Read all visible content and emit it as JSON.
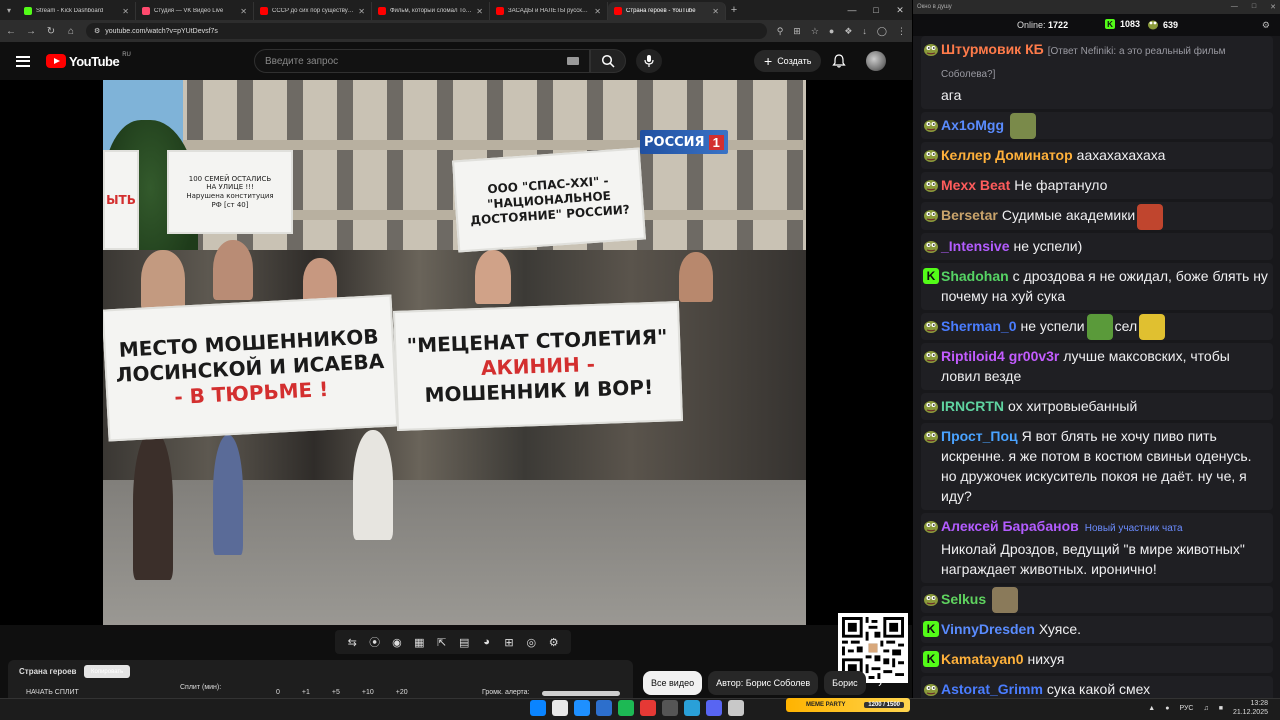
{
  "browser": {
    "tabs": [
      {
        "title": "Stream - Kick Dashboard",
        "color": "#53fc18"
      },
      {
        "title": "Студия — VK Видео Live",
        "color": "#ff4a6e"
      },
      {
        "title": "СССР до сих пор существует? ...",
        "color": "#ff0000"
      },
      {
        "title": "Фильм, который сломал Томь...",
        "color": "#ff0000"
      },
      {
        "title": "ЗАСАДЫ и НАЛЁТЫ русских Р...",
        "color": "#ff0000"
      },
      {
        "title": "Страна героев - YouTube",
        "color": "#ff0000"
      }
    ],
    "url": "youtube.com/watch?v=pYUtDevsf7s"
  },
  "youtube": {
    "logo_text": "YouTube",
    "region": "RU",
    "search_placeholder": "Введите запрос",
    "create_label": "Создать"
  },
  "video": {
    "channel_logo": "РОССИЯ",
    "channel_num": "1",
    "banner_left": [
      "МЕСТО МОШЕННИКОВ",
      "ЛОСИНСКОЙ И ИСАЕВА",
      "- В ТЮРЬМЕ !"
    ],
    "banner_right": [
      "\"МЕЦЕНАТ СТОЛЕТИЯ\"",
      "АКИНИН -",
      "МОШЕННИК И ВОР!"
    ],
    "banner_top_mid": [
      "ООО \"СПАС-XXI\" -",
      "\"НАЦИОНАЛЬНОЕ",
      "ДОСТОЯНИЕ\" РОССИИ?"
    ],
    "banner_top_left": [
      "100 СЕМЕЙ ОСТАЛИСЬ",
      "НА УЛИЦЕ !!!",
      "Нарушена конституция",
      "РФ [ст 40]"
    ],
    "banner_edge": "ЫТЬ"
  },
  "below": {
    "panel_title": "Страна героев",
    "panel_tag": "Копировать",
    "start_split": "НАЧАТЬ СПЛИТ",
    "split_label": "Сплит (мин):",
    "split_values": [
      "0",
      "+1",
      "+5",
      "+10",
      "+20"
    ],
    "volume_label": "Громк. алерта:",
    "chips": [
      "Все видео",
      "Автор: Борис Соболев",
      "Борис"
    ]
  },
  "chat": {
    "window_title": "Окно в душу",
    "online_label": "Online:",
    "online_count": "1722",
    "kick_count": "1083",
    "other_count": "639",
    "messages": [
      {
        "name": "Штурмовик КБ",
        "color": "#ff7b4a",
        "reply": "[Ответ Nefiniki: а это реальный фильм Соболева?]",
        "text": "ага",
        "badge": "pepe"
      },
      {
        "name": "Ax1oMgg",
        "color": "#5a8cff",
        "text": "",
        "badge": "pepe",
        "emote": "#7a8a4a"
      },
      {
        "name": "Келлер Доминатор",
        "color": "#ffb13b",
        "text": "аахахахахаха",
        "badge": "pepe"
      },
      {
        "name": "Mexx Beat",
        "color": "#ff5c5c",
        "text": "Не фартануло",
        "badge": "pepe"
      },
      {
        "name": "Bersetar",
        "color": "#c9a36b",
        "text": "Судимые академики",
        "badge": "pepe",
        "emote": "#c0452e"
      },
      {
        "name": "_Intensive",
        "color": "#b35cff",
        "text": "не успели)",
        "badge": "pepe"
      },
      {
        "name": "Shadohan",
        "color": "#56d364",
        "text": "с дроздова я не ожидал, боже блять ну почему на хуй сука",
        "badge": "kick"
      },
      {
        "name": "Sherman_0",
        "color": "#4a7dff",
        "text": "не успели",
        "text2": "сел",
        "badge": "pepe",
        "emote": "#5a9a3a",
        "emote2": "#e0c030"
      },
      {
        "name": "Riptiloid4",
        "color": "#c35cff",
        "name2": "gr00v3r",
        "color2": "#c35cff",
        "text": "лучше максовских, чтобы ловил везде",
        "badge": "pepe"
      },
      {
        "name": "IRNCRTN",
        "color": "#5fd3a0",
        "text": "ох хитровыебанный",
        "badge": "pepe"
      },
      {
        "name": "Прост_Поц",
        "color": "#4aa3ff",
        "text": "Я вот блять не хочу пиво пить искренне. я же потом в костюм свиньи оденусь. но дружочек искуситель покоя не даёт. ну че, я иду?",
        "badge": "pepe"
      },
      {
        "name": "Алексей Барабанов",
        "color": "#b35cff",
        "newtag": "Новый участник чата",
        "text": "Николай Дроздов, ведущий \"в мире животных\" награждает животных. иронично!",
        "badge": "pepe"
      },
      {
        "name": "Selkus",
        "color": "#5fd35f",
        "text": "",
        "badge": "pepe",
        "emote": "#8a7a5a"
      },
      {
        "name": "VinnyDresden",
        "color": "#5a8cff",
        "text": "Хуясе.",
        "badge": "kick"
      },
      {
        "name": "Kamatayan0",
        "color": "#ffb13b",
        "text": "нихуя",
        "badge": "kick"
      },
      {
        "name": "Astorat_Grimm",
        "color": "#4a7dff",
        "text": "сука какой смех",
        "badge": "pepe"
      }
    ]
  },
  "taskbar": {
    "meme_label": "MEME PARTY",
    "meme_count": "1200 / 1500",
    "lang": "РУС",
    "time": "13:28",
    "date": "21.12.2025"
  }
}
